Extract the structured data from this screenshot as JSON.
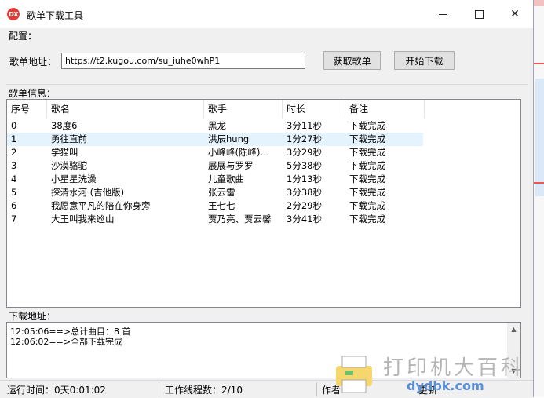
{
  "window": {
    "title": "歌单下载工具",
    "icon_text": "DX",
    "icon_color": "#e53935"
  },
  "config": {
    "section_label": "配置：",
    "url_label": "歌单地址：",
    "url_value": "https://t2.kugou.com/su_iuhe0whP1",
    "fetch_button": "获取歌单",
    "start_button": "开始下载"
  },
  "playlist": {
    "section_label": "歌单信息：",
    "columns": [
      "序号",
      "歌名",
      "歌手",
      "时长",
      "备注"
    ],
    "rows": [
      {
        "idx": "0",
        "name": "38度6",
        "artist": "黑龙",
        "duration": "3分11秒",
        "note": "下载完成"
      },
      {
        "idx": "1",
        "name": "勇往直前",
        "artist": "洪辰hung",
        "duration": "1分27秒",
        "note": "下载完成"
      },
      {
        "idx": "2",
        "name": "学猫叫",
        "artist": "小峰峰(陈峰)…",
        "duration": "3分29秒",
        "note": "下载完成"
      },
      {
        "idx": "3",
        "name": "沙漠骆驼",
        "artist": "展展与罗罗",
        "duration": "5分38秒",
        "note": "下载完成"
      },
      {
        "idx": "4",
        "name": "小星星洗澡",
        "artist": "儿童歌曲",
        "duration": "1分13秒",
        "note": "下载完成"
      },
      {
        "idx": "5",
        "name": "探清水河 (吉他版)",
        "artist": "张云雷",
        "duration": "3分38秒",
        "note": "下载完成"
      },
      {
        "idx": "6",
        "name": "我愿意平凡的陪在你身旁",
        "artist": "王七七",
        "duration": "2分29秒",
        "note": "下载完成"
      },
      {
        "idx": "7",
        "name": "大王叫我来巡山",
        "artist": "贾乃亮、贾云馨",
        "duration": "3分41秒",
        "note": "下载完成"
      }
    ],
    "selected_row": 1
  },
  "download": {
    "section_label": "下载地址：",
    "log": [
      "12:05:06==>总计曲目：8 首",
      "12:06:02==>全部下载完成"
    ]
  },
  "status": {
    "runtime": "运行时间：0天0:01:02",
    "threads": "工作线程数：2/10",
    "author": "作者",
    "extra": "更新"
  },
  "watermark": {
    "text": "打印机大百科",
    "sub": "dydbk.com"
  }
}
